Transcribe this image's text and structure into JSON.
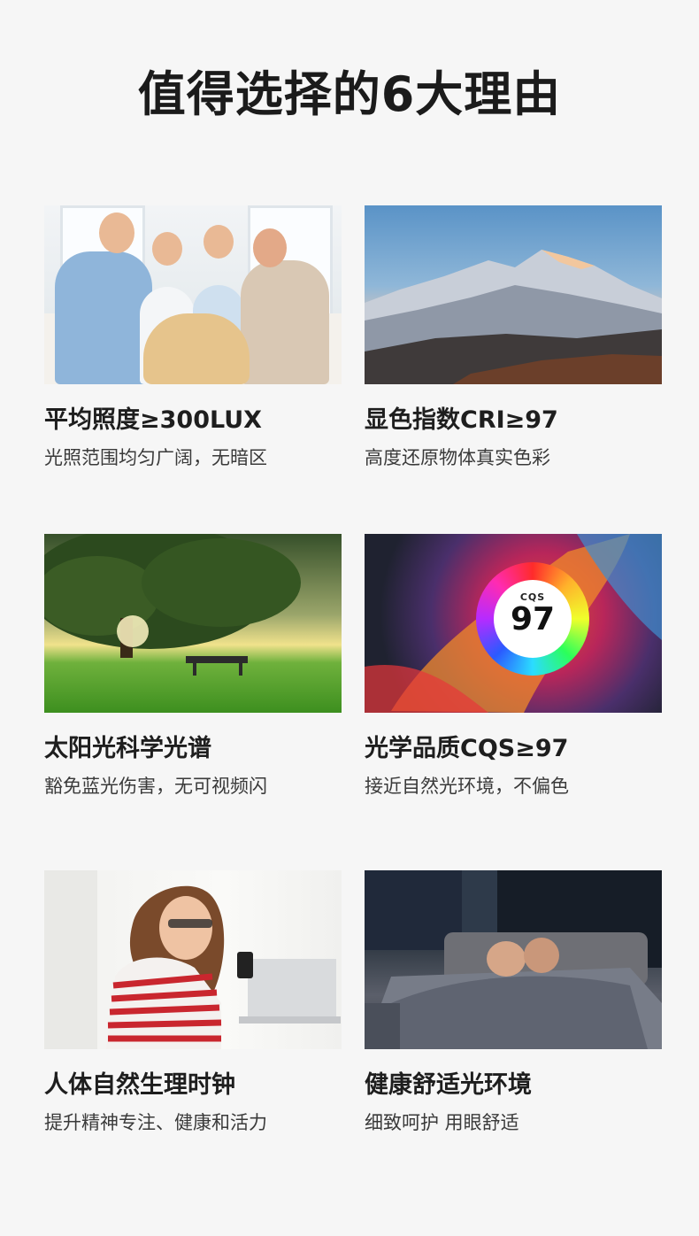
{
  "page": {
    "title": "值得选择的6大理由"
  },
  "cards": [
    {
      "title": "平均照度≥300LUX",
      "subtitle": "光照范围均匀广阔，无暗区"
    },
    {
      "title": "显色指数CRI≥97",
      "subtitle": "高度还原物体真实色彩"
    },
    {
      "title": "太阳光科学光谱",
      "subtitle": "豁免蓝光伤害，无可视频闪"
    },
    {
      "title": "光学品质CQS≥97",
      "subtitle": "接近自然光环境，不偏色"
    },
    {
      "title": "人体自然生理时钟",
      "subtitle": "提升精神专注、健康和活力"
    },
    {
      "title": "健康舒适光环境",
      "subtitle": "细致呵护 用眼舒适"
    }
  ],
  "cqs_badge": {
    "label": "CQS",
    "value": "97"
  },
  "colors": {
    "background": "#f6f6f6",
    "title": "#1b1b1b",
    "subtitle": "#3a3a3a"
  }
}
